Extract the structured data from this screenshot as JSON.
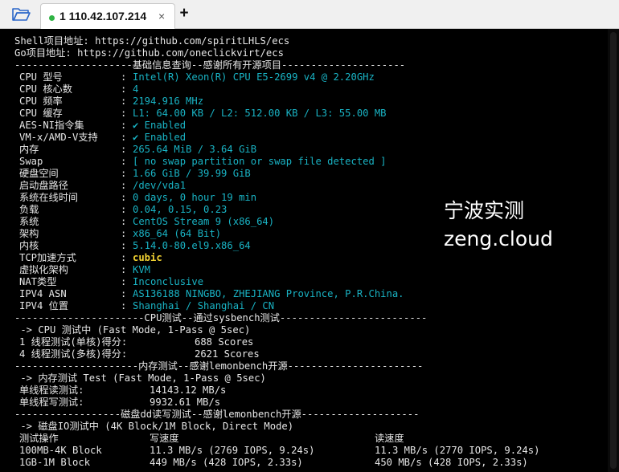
{
  "tabbar": {
    "folder_icon": "folder-open-icon",
    "tab_title": "1 110.42.107.214",
    "tab_close": "×",
    "new_tab": "+",
    "status_color": "#2fb344"
  },
  "terminal": {
    "shell_repo": "Shell项目地址: https://github.com/spiritLHLS/ecs",
    "go_repo": "Go项目地址: https://github.com/oneclickvirt/ecs",
    "basic_header": "--------------------基础信息查询--感谢所有开源项目---------------------",
    "basic": [
      {
        "key": "CPU 型号",
        "value": "Intel(R) Xeon(R) CPU E5-2699 v4 @ 2.20GHz"
      },
      {
        "key": "CPU 核心数",
        "value": "4"
      },
      {
        "key": "CPU 频率",
        "value": "2194.916 MHz"
      },
      {
        "key": "CPU 缓存",
        "value": "L1: 64.00 KB / L2: 512.00 KB / L3: 55.00 MB"
      },
      {
        "key": "AES-NI指令集",
        "value": "✔ Enabled"
      },
      {
        "key": "VM-x/AMD-V支持",
        "value": "✔ Enabled"
      },
      {
        "key": "内存",
        "value": "265.64 MiB / 3.64 GiB"
      },
      {
        "key": "Swap",
        "value": "[ no swap partition or swap file detected ]"
      },
      {
        "key": "硬盘空间",
        "value": "1.66 GiB / 39.99 GiB"
      },
      {
        "key": "启动盘路径",
        "value": "/dev/vda1"
      },
      {
        "key": "系统在线时间",
        "value": "0 days, 0 hour 19 min"
      },
      {
        "key": "负载",
        "value": "0.04, 0.15, 0.23"
      },
      {
        "key": "系统",
        "value": "CentOS Stream 9 (x86_64)"
      },
      {
        "key": "架构",
        "value": "x86_64 (64 Bit)"
      },
      {
        "key": "内核",
        "value": "5.14.0-80.el9.x86_64"
      },
      {
        "key": "TCP加速方式",
        "value": "cubic"
      },
      {
        "key": "虚拟化架构",
        "value": "KVM"
      },
      {
        "key": "NAT类型",
        "value": "Inconclusive"
      },
      {
        "key": "IPV4 ASN",
        "value": "AS136188 NINGBO, ZHEJIANG Province, P.R.China."
      },
      {
        "key": "IPV4 位置",
        "value": "Shanghai / Shanghai / CN"
      }
    ],
    "separator": ":",
    "cpu_header": "----------------------CPU测试--通过sysbench测试-------------------------",
    "cpu_mode": " -> CPU 测试中 (Fast Mode, 1-Pass @ 5sec)",
    "cpu_results": [
      {
        "label": "1 线程测试(单核)得分:",
        "value": "688 Scores"
      },
      {
        "label": "4 线程测试(多核)得分:",
        "value": "2621 Scores"
      }
    ],
    "mem_header": "---------------------内存测试--感谢lemonbench开源-----------------------",
    "mem_mode": " -> 内存测试 Test (Fast Mode, 1-Pass @ 5sec)",
    "mem_results": [
      {
        "label": "单线程读测试:",
        "value": "14143.12 MB/s"
      },
      {
        "label": "单线程写测试:",
        "value": "9932.61 MB/s"
      }
    ],
    "disk_header": "------------------磁盘dd读写测试--感谢lemonbench开源--------------------",
    "disk_mode": " -> 磁盘IO测试中 (4K Block/1M Block, Direct Mode)",
    "disk_columns": [
      "测试操作",
      "写速度",
      "读速度"
    ],
    "disk_rows": [
      {
        "op": "100MB-4K Block",
        "write": "11.3 MB/s (2769 IOPS, 9.24s)",
        "read": "11.3 MB/s (2770 IOPS, 9.24s)"
      },
      {
        "op": "1GB-1M Block",
        "write": "449 MB/s (428 IOPS, 2.33s)",
        "read": "450 MB/s (428 IOPS, 2.33s)"
      }
    ]
  },
  "watermark": {
    "line1": "宁波实测",
    "line2": "zeng.cloud"
  },
  "colors": {
    "value_cyan": "#19b3c4",
    "highlight_yellow": "#f3d332",
    "background": "#000000"
  }
}
